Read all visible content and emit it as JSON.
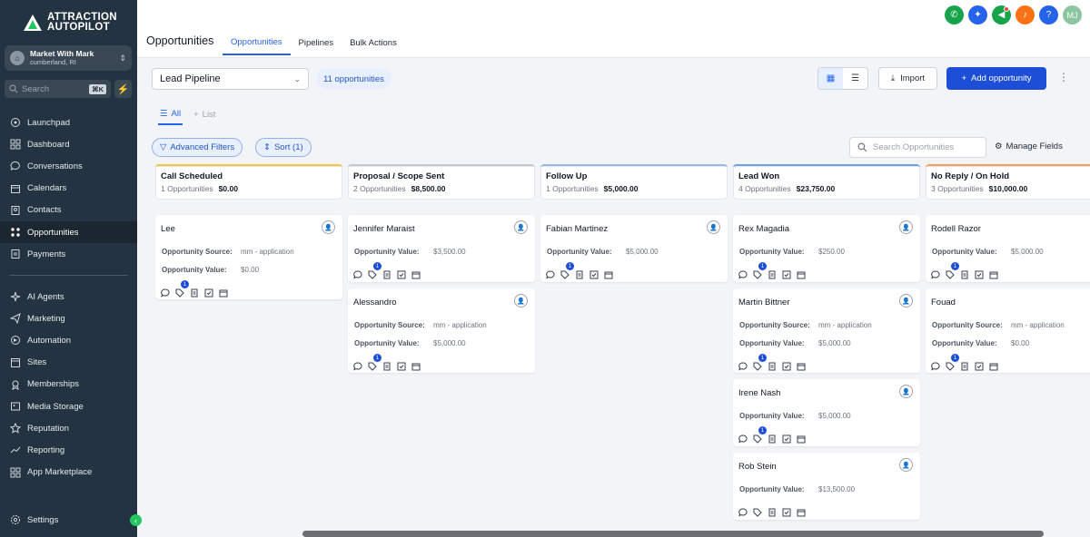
{
  "brand": {
    "line1": "ATTRACTION",
    "line2": "AUTOPILOT"
  },
  "account": {
    "name": "Market With Mark",
    "location": "cumberland, RI"
  },
  "sidebar_search": {
    "placeholder": "Search",
    "shortcut": "⌘K"
  },
  "nav": {
    "items": [
      {
        "label": "Launchpad",
        "icon": "rocket-icon"
      },
      {
        "label": "Dashboard",
        "icon": "grid-icon"
      },
      {
        "label": "Conversations",
        "icon": "chat-icon"
      },
      {
        "label": "Calendars",
        "icon": "calendar-icon"
      },
      {
        "label": "Contacts",
        "icon": "contacts-icon"
      },
      {
        "label": "Opportunities",
        "icon": "opportunities-icon"
      },
      {
        "label": "Payments",
        "icon": "payments-icon"
      }
    ],
    "items2": [
      {
        "label": "AI Agents",
        "icon": "sparkle-icon"
      },
      {
        "label": "Marketing",
        "icon": "send-icon"
      },
      {
        "label": "Automation",
        "icon": "automation-icon"
      },
      {
        "label": "Sites",
        "icon": "sites-icon"
      },
      {
        "label": "Memberships",
        "icon": "memberships-icon"
      },
      {
        "label": "Media Storage",
        "icon": "media-icon"
      },
      {
        "label": "Reputation",
        "icon": "star-icon"
      },
      {
        "label": "Reporting",
        "icon": "chart-icon"
      },
      {
        "label": "App Marketplace",
        "icon": "apps-icon"
      }
    ],
    "settings": "Settings"
  },
  "header": {
    "title": "Opportunities",
    "tabs": [
      "Opportunities",
      "Pipelines",
      "Bulk Actions"
    ],
    "avatar": "MJ",
    "help": "?"
  },
  "toolbar": {
    "pipeline": "Lead Pipeline",
    "count": "11 opportunities",
    "import": "Import",
    "add": "Add opportunity"
  },
  "view_tabs": {
    "all": "All",
    "list": "List"
  },
  "filters": {
    "advanced": "Advanced Filters",
    "sort": "Sort (1)",
    "search_placeholder": "Search Opportunities",
    "manage": "Manage Fields"
  },
  "columns": [
    {
      "name": "Call Scheduled",
      "count": "1 Opportunities",
      "total": "$0.00",
      "accent": "#f5c542",
      "cards": [
        {
          "name": "Lee",
          "fields": [
            [
              "Opportunity Source:",
              "mm - application"
            ],
            [
              "Opportunity Value:",
              "$0.00"
            ]
          ]
        }
      ]
    },
    {
      "name": "Proposal / Scope Sent",
      "count": "2 Opportunities",
      "total": "$8,500.00",
      "accent": "#c3c8cf",
      "cards": [
        {
          "name": "Jennifer Maraist",
          "fields": [
            [
              "Opportunity Value:",
              "$3,500.00"
            ]
          ]
        },
        {
          "name": "Alessandro",
          "fields": [
            [
              "Opportunity Source:",
              "mm - application"
            ],
            [
              "Opportunity Value:",
              "$5,000.00"
            ]
          ]
        }
      ]
    },
    {
      "name": "Follow Up",
      "count": "1 Opportunities",
      "total": "$5,000.00",
      "accent": "#9ab7ea",
      "cards": [
        {
          "name": "Fabian Martinez",
          "fields": [
            [
              "Opportunity Value:",
              "$5,000.00"
            ]
          ]
        }
      ]
    },
    {
      "name": "Lead Won",
      "count": "4 Opportunities",
      "total": "$23,750.00",
      "accent": "#6fa0e8",
      "cards": [
        {
          "name": "Rex Magadia",
          "fields": [
            [
              "Opportunity Value:",
              "$250.00"
            ]
          ]
        },
        {
          "name": "Martin Bittner",
          "fields": [
            [
              "Opportunity Source:",
              "mm - application"
            ],
            [
              "Opportunity Value:",
              "$5,000.00"
            ]
          ]
        },
        {
          "name": "Irene Nash",
          "fields": [
            [
              "Opportunity Value:",
              "$5,000.00"
            ]
          ]
        },
        {
          "name": "Rob Stein",
          "fields": [
            [
              "Opportunity Value:",
              "$13,500.00"
            ]
          ]
        }
      ]
    },
    {
      "name": "No Reply / On Hold",
      "count": "3 Opportunities",
      "total": "$10,000.00",
      "accent": "#f59e5b",
      "cards": [
        {
          "name": "Rodell Razor",
          "fields": [
            [
              "Opportunity Value:",
              "$5,000.00"
            ]
          ]
        },
        {
          "name": "Fouad",
          "fields": [
            [
              "Opportunity Source:",
              "mm - application"
            ],
            [
              "Opportunity Value:",
              "$0.00"
            ]
          ]
        }
      ]
    }
  ],
  "card_badge": "1"
}
